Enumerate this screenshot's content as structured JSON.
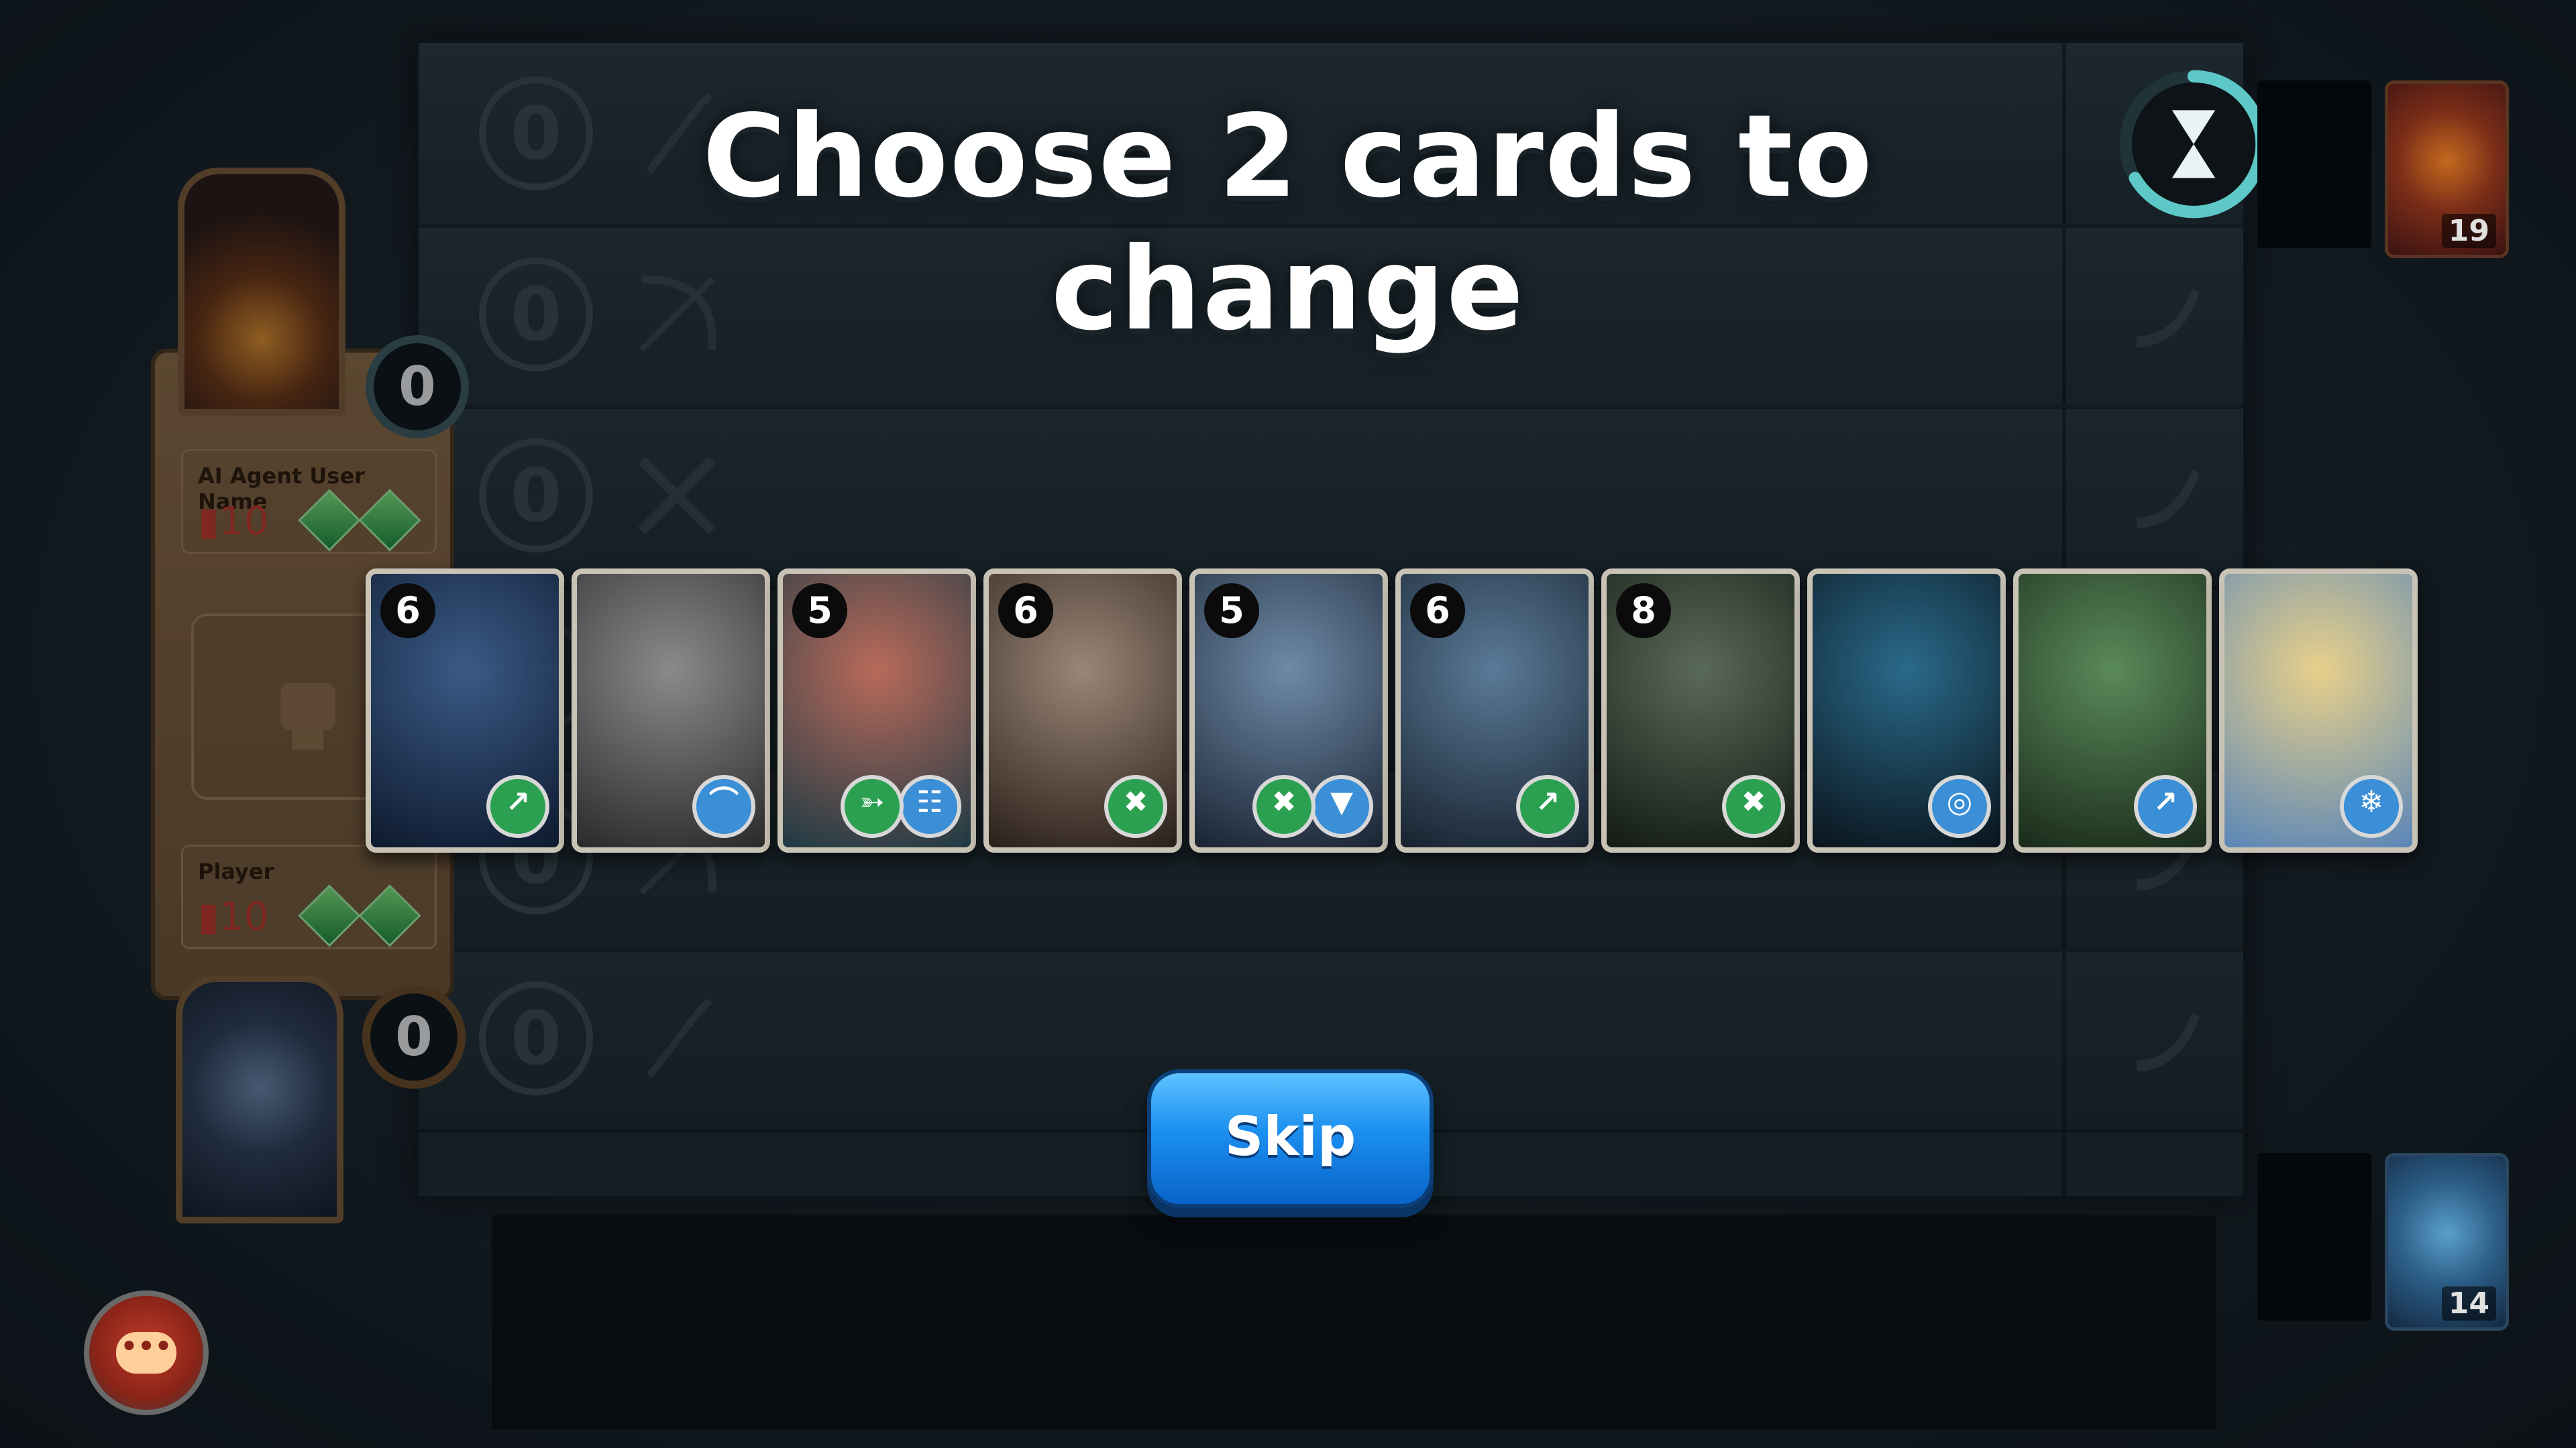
{
  "title": "Choose 2 cards to change",
  "skip_label": "Skip",
  "ai": {
    "name": "AI Agent User Name",
    "cards_in_hand": "10",
    "total_score": "0",
    "deck_count": "19"
  },
  "player": {
    "name": "Player",
    "cards_in_hand": "10",
    "total_score": "0",
    "deck_count": "14"
  },
  "lanes": [
    {
      "score": "0",
      "icon": "sword-icon"
    },
    {
      "score": "0",
      "icon": "bow-icon"
    },
    {
      "score": "0",
      "icon": "crossed-swords-icon"
    },
    {
      "score": "0",
      "icon": "crossed-swords-icon"
    },
    {
      "score": "0",
      "icon": "bow-icon"
    },
    {
      "score": "0",
      "icon": "sword-icon"
    }
  ],
  "hand": [
    {
      "cost": "6",
      "abilities": [
        "sword-icon"
      ],
      "art": [
        "#3a5a86",
        "#0e1a2e"
      ]
    },
    {
      "cost": "",
      "abilities": [
        "horn-icon"
      ],
      "art": [
        "#8a8a8a",
        "#2a2a2a"
      ]
    },
    {
      "cost": "5",
      "abilities": [
        "bow-icon",
        "scroll-icon"
      ],
      "art": [
        "#b86a5a",
        "#1e3a44"
      ]
    },
    {
      "cost": "6",
      "abilities": [
        "crossed-swords-icon"
      ],
      "art": [
        "#9a8676",
        "#2a201a"
      ]
    },
    {
      "cost": "5",
      "abilities": [
        "crossed-swords-icon",
        "shield-icon"
      ],
      "art": [
        "#6e8aa8",
        "#1a2432"
      ]
    },
    {
      "cost": "6",
      "abilities": [
        "sword-icon"
      ],
      "art": [
        "#5a7a98",
        "#18222e"
      ]
    },
    {
      "cost": "8",
      "abilities": [
        "crossed-swords-icon"
      ],
      "art": [
        "#5a6a58",
        "#121a14"
      ]
    },
    {
      "cost": "",
      "abilities": [
        "target-icon"
      ],
      "art": [
        "#2a6a8a",
        "#0a141c"
      ]
    },
    {
      "cost": "",
      "abilities": [
        "sword-icon"
      ],
      "art": [
        "#5a8a5a",
        "#1a2a1a"
      ]
    },
    {
      "cost": "",
      "abilities": [
        "snowflake-icon"
      ],
      "art": [
        "#e8d08a",
        "#5a86b8"
      ]
    }
  ]
}
